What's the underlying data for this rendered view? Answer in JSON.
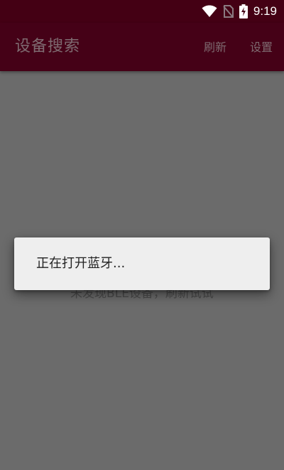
{
  "status_bar": {
    "time": "9:19",
    "icons": [
      "wifi-icon",
      "no-sim-icon",
      "battery-charging-icon"
    ]
  },
  "app_bar": {
    "title": "设备搜索",
    "actions": {
      "refresh": "刷新",
      "settings": "设置"
    }
  },
  "main": {
    "empty_hint": "未发现BLE设备，刷新试试"
  },
  "dialog": {
    "message": "正在打开蓝牙..."
  },
  "colors": {
    "status_bar": "#440014",
    "app_bar": "#450117",
    "scrim_background": "#6b6b6b",
    "dialog_background": "#eeeeee"
  }
}
